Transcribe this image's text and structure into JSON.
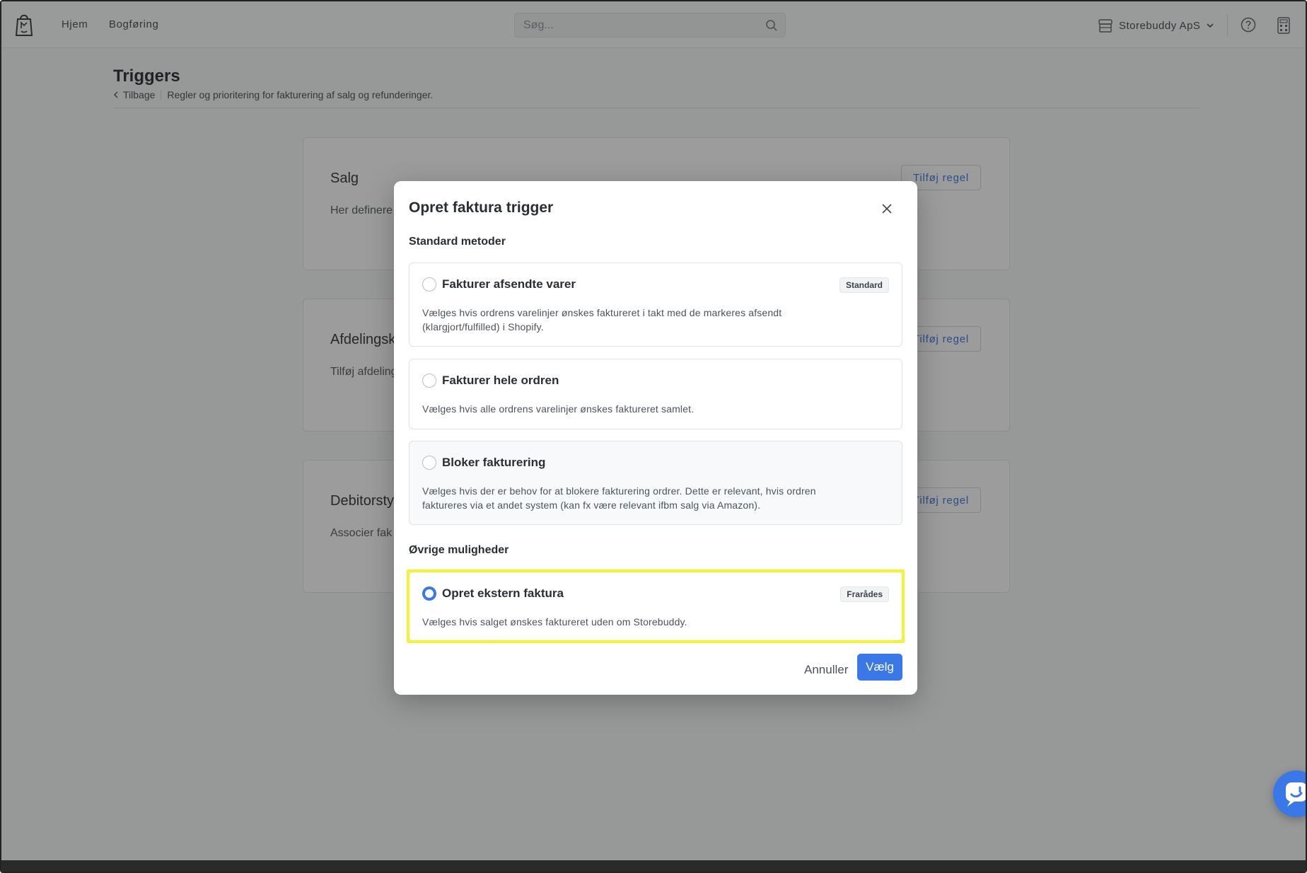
{
  "topbar": {
    "nav": [
      "Hjem",
      "Bogføring"
    ],
    "search_placeholder": "Søg...",
    "store_name": "Storebuddy ApS"
  },
  "page": {
    "title": "Triggers",
    "back_label": "Tilbage",
    "subtitle": "Regler og prioritering for fakturering af salg og refunderinger."
  },
  "cards": [
    {
      "title": "Salg",
      "desc": "Her definere",
      "button": "Tilføj regel"
    },
    {
      "title": "Afdelingsk",
      "desc": "Tilføj afdeling",
      "button": "Tilføj regel"
    },
    {
      "title": "Debitorsty",
      "desc": "Associer fak",
      "button": "Tilføj regel"
    }
  ],
  "modal": {
    "title": "Opret faktura trigger",
    "section_standard": "Standard metoder",
    "section_other": "Øvrige muligheder",
    "options": [
      {
        "title": "Fakturer afsendte varer",
        "badge": "Standard",
        "desc": "Vælges hvis ordrens varelinjer ønskes faktureret i takt med de markeres afsendt (klargjort/fulfilled) i Shopify.",
        "selected": false
      },
      {
        "title": "Fakturer hele ordren",
        "badge": "",
        "desc": "Vælges hvis alle ordrens varelinjer ønskes faktureret samlet.",
        "selected": false
      },
      {
        "title": "Bloker fakturering",
        "badge": "",
        "desc": "Vælges hvis der er behov for at blokere fakturering ordrer. Dette er relevant, hvis ordren faktureres via et andet system (kan fx være relevant ifbm salg via Amazon).",
        "selected": false
      },
      {
        "title": "Opret ekstern faktura",
        "badge": "Frarådes",
        "desc": "Vælges hvis salget ønskes faktureret uden om Storebuddy.",
        "selected": true
      }
    ],
    "cancel_label": "Annuller",
    "confirm_label": "Vælg"
  },
  "colors": {
    "accent": "#3b78e7",
    "highlight": "#f5f231",
    "overlay": "rgba(40,40,40,0.46)"
  },
  "icons": [
    "storebuddy-logo-icon",
    "search-icon",
    "store-icon",
    "chevron-down-icon",
    "help-icon",
    "calculator-icon",
    "chevron-left-icon",
    "close-icon",
    "chat-icon"
  ]
}
